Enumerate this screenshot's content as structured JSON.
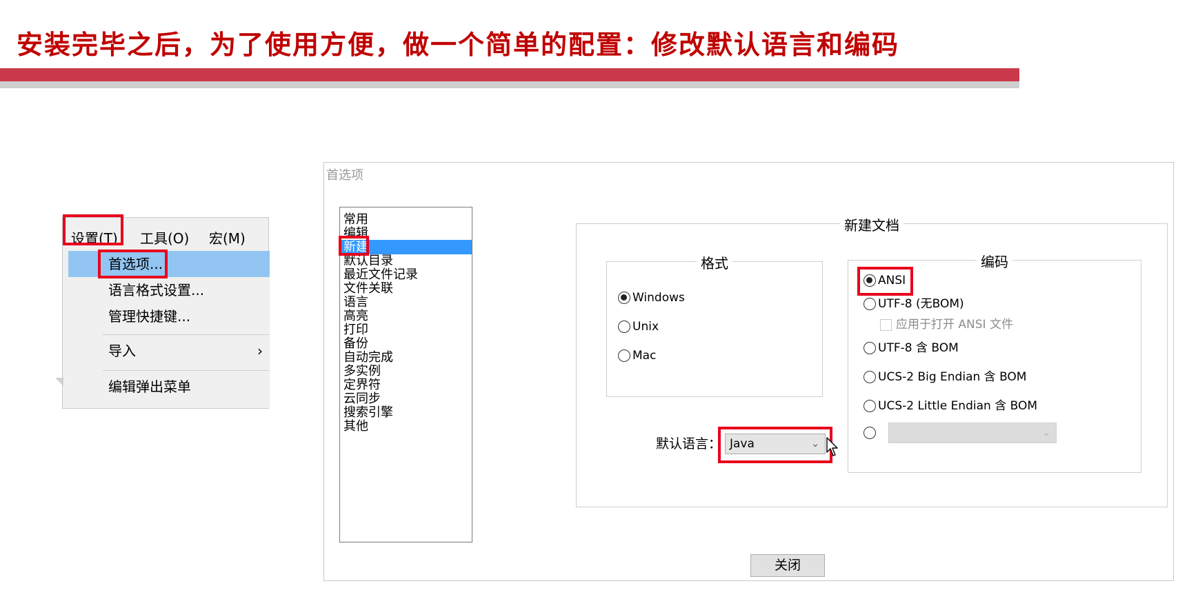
{
  "slide": {
    "title": "安装完毕之后，为了使用方便，做一个简单的配置：修改默认语言和编码"
  },
  "menu": {
    "menubar": [
      "设置(T)",
      "工具(O)",
      "宏(M)"
    ],
    "items": [
      {
        "label": "首选项..."
      },
      {
        "label": "语言格式设置..."
      },
      {
        "label": "管理快捷键..."
      },
      {
        "label": "导入",
        "submenu_arrow": "›"
      },
      {
        "label": "编辑弹出菜单"
      }
    ]
  },
  "preferences": {
    "title": "首选项",
    "categories": [
      "常用",
      "编辑",
      "新建",
      "默认目录",
      "最近文件记录",
      "文件关联",
      "语言",
      "高亮",
      "打印",
      "备份",
      "自动完成",
      "多实例",
      "定界符",
      "云同步",
      "搜索引擎",
      "其他"
    ],
    "selected_category": "新建",
    "new_document": {
      "group_title": "新建文档",
      "format": {
        "title": "格式",
        "options": [
          "Windows",
          "Unix",
          "Mac"
        ],
        "selected": "Windows"
      },
      "encoding": {
        "title": "编码",
        "options": [
          "ANSI",
          "UTF-8 (无BOM)",
          "UTF-8 含 BOM",
          "UCS-2 Big Endian 含 BOM",
          "UCS-2 Little Endian 含 BOM"
        ],
        "selected": "ANSI",
        "apply_checkbox_label": "应用于打开 ANSI 文件",
        "other_select_value": ""
      },
      "default_language_label": "默认语言：",
      "default_language_value": "Java"
    },
    "close_button": "关闭"
  },
  "colors": {
    "title_red": "#c00000",
    "highlight_red": "#e8001c",
    "bar_red": "#c9394b",
    "menu_selection": "#92c5f2",
    "list_selection": "#3399ff"
  },
  "icons": {
    "submenu": "chevron-right-icon",
    "dropdown": "chevron-down-icon",
    "pointer": "mouse-cursor-icon"
  }
}
